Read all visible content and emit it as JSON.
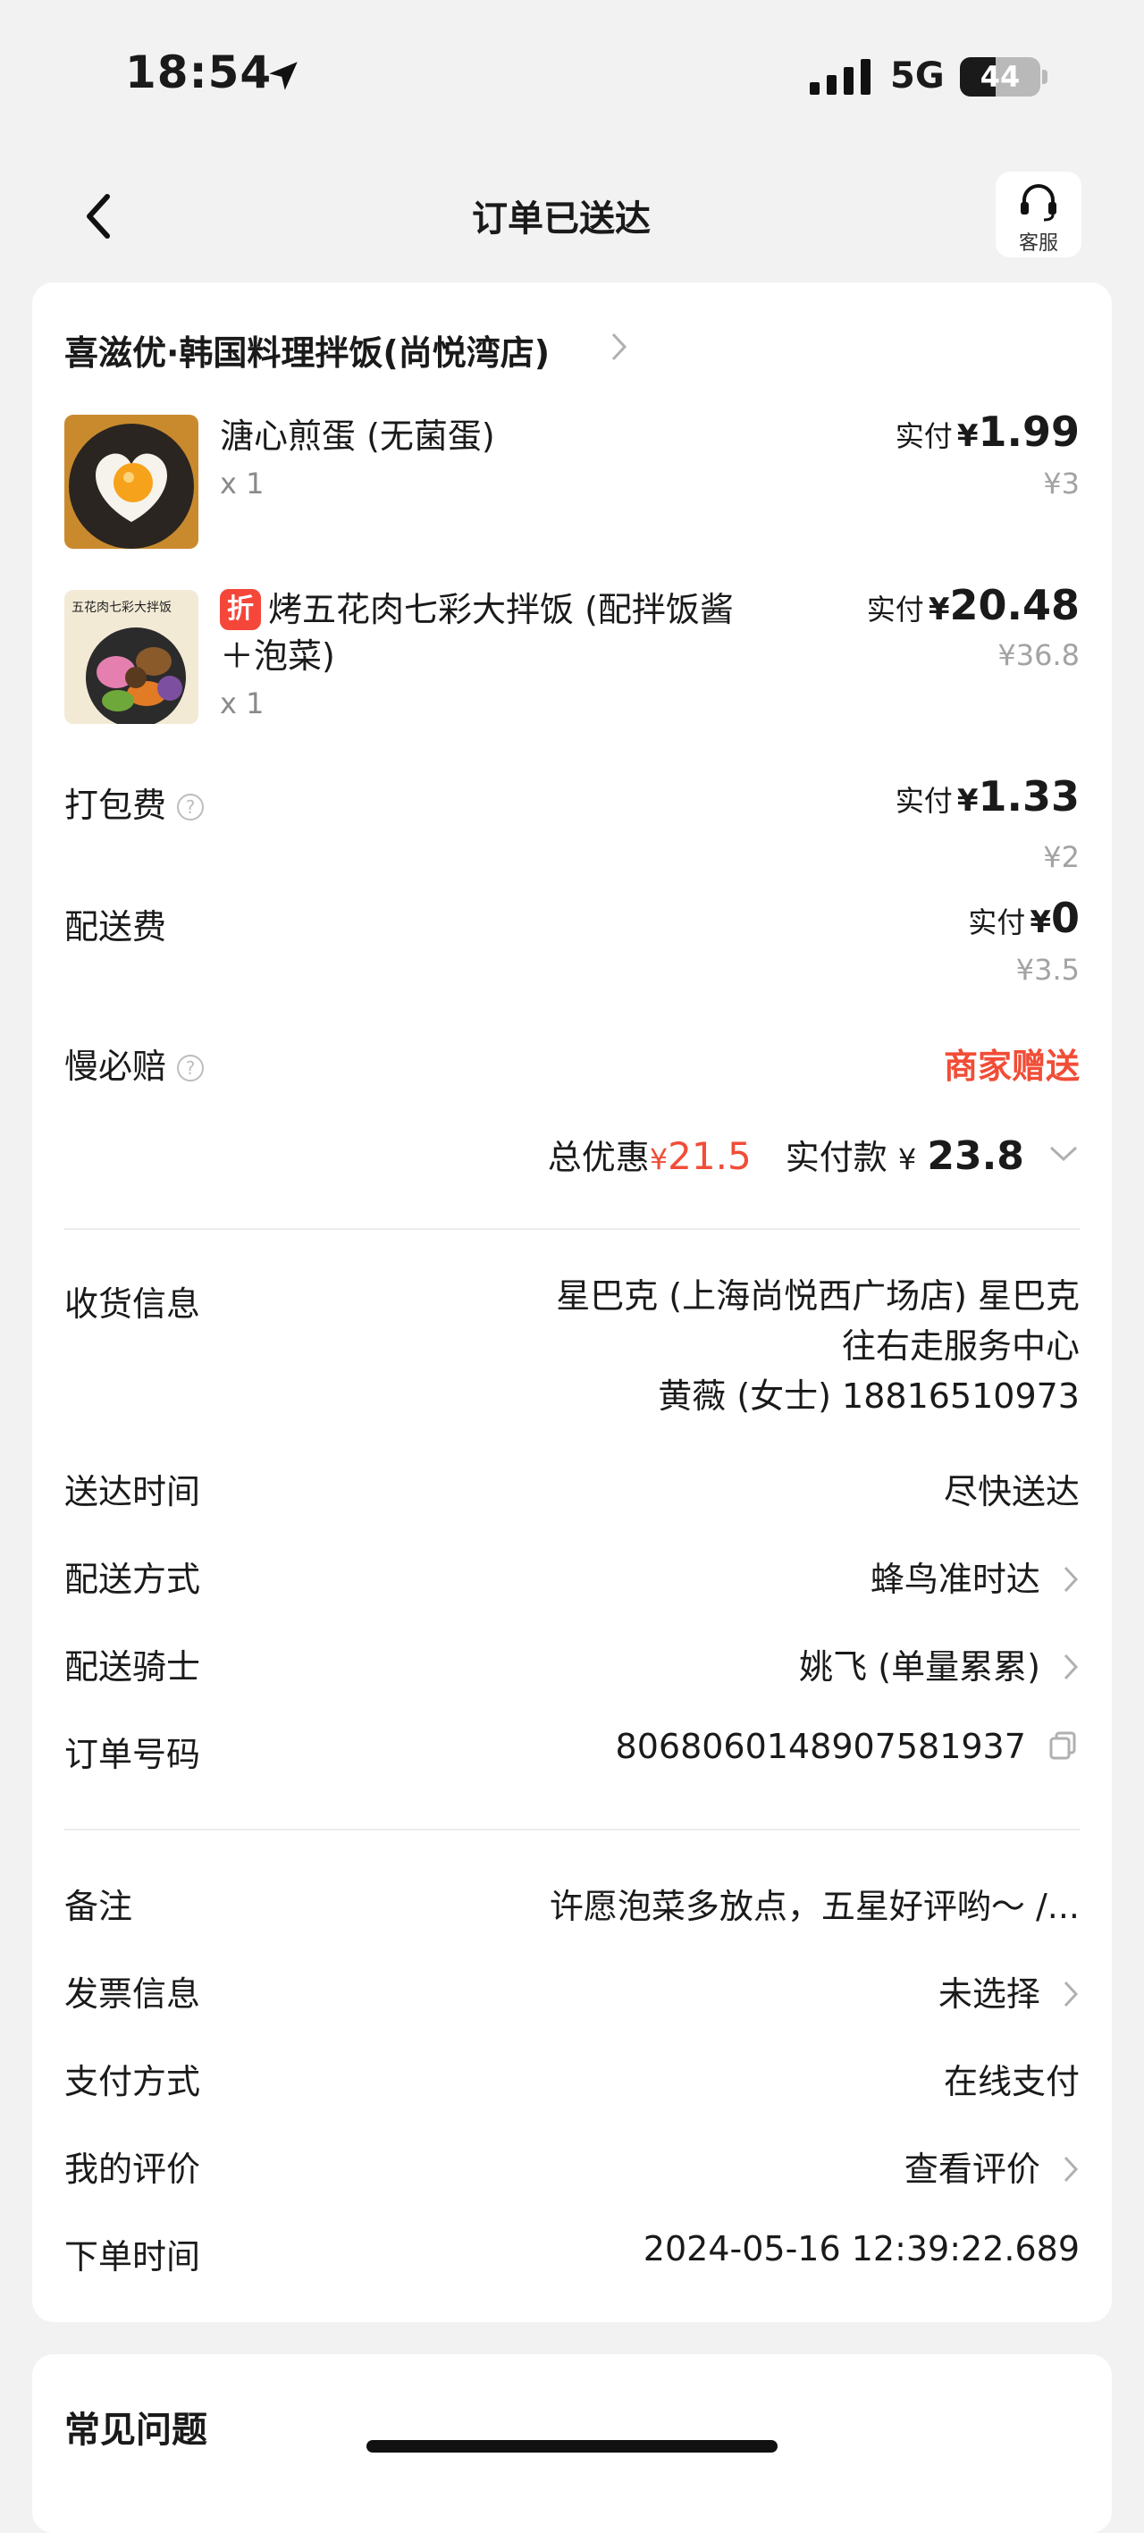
{
  "status_bar": {
    "time": "18:54",
    "network": "5G",
    "battery": "44",
    "battery_level": 0.44
  },
  "nav": {
    "title": "订单已送达",
    "service_label": "客服"
  },
  "store": {
    "name": "喜滋优·韩国料理拌饭(尚悦湾店)"
  },
  "items": [
    {
      "name": "溏心煎蛋 (无菌蛋)",
      "qty": "x 1",
      "paid_label": "实付",
      "currency": "¥",
      "paid": "1.99",
      "original": "¥3"
    },
    {
      "badge": "折",
      "name": "烤五花肉七彩大拌饭 (配拌饭酱",
      "name_line2": "＋泡菜)",
      "qty": "x 1",
      "paid_label": "实付",
      "currency": "¥",
      "paid": "20.48",
      "original": "¥36.8",
      "image_caption": "五花肉七彩大拌饭"
    }
  ],
  "fees": {
    "packing": {
      "label": "打包费",
      "paid_label": "实付",
      "currency": "¥",
      "paid": "1.33",
      "original": "¥2"
    },
    "delivery": {
      "label": "配送费",
      "paid_label": "实付",
      "currency": "¥",
      "paid": "0",
      "original": "¥3.5"
    },
    "late_guarantee": {
      "label": "慢必赔",
      "value": "商家赠送"
    }
  },
  "totals": {
    "discount_label": "总优惠",
    "discount_currency": "¥",
    "discount": "21.5",
    "paid_label": "实付款",
    "currency": "¥",
    "paid": "23.8"
  },
  "delivery_info": {
    "receiver_label": "收货信息",
    "address_line1": "星巴克 (上海尚悦西广场店) 星巴克",
    "address_line2": "往右走服务中心",
    "contact": "黄薇 (女士) 18816510973",
    "time_label": "送达时间",
    "time_value": "尽快送达",
    "method_label": "配送方式",
    "method_value": "蜂鸟准时达",
    "rider_label": "配送骑士",
    "rider_value": "姚飞 (单量累累)",
    "order_no_label": "订单号码",
    "order_no": "8068060148907581937"
  },
  "extra_info": {
    "note_label": "备注",
    "note_value": "许愿泡菜多放点，五星好评哟～ /...",
    "invoice_label": "发票信息",
    "invoice_value": "未选择",
    "payment_label": "支付方式",
    "payment_value": "在线支付",
    "review_label": "我的评价",
    "review_value": "查看评价",
    "order_time_label": "下单时间",
    "order_time_value": "2024-05-16 12:39:22.689"
  },
  "faq": {
    "title": "常见问题"
  }
}
